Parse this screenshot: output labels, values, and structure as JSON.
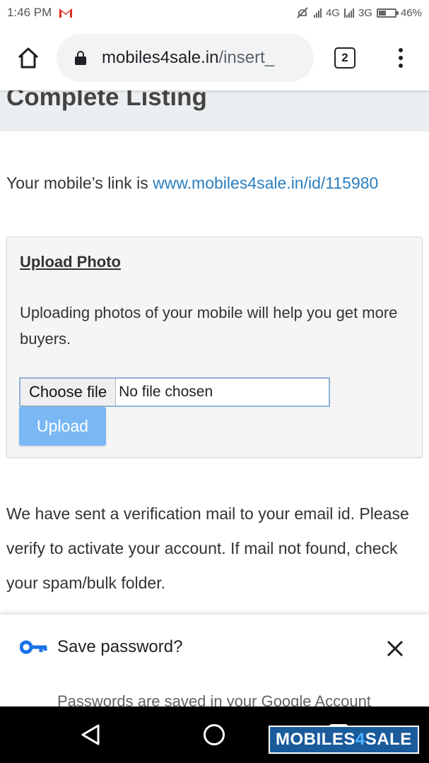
{
  "status_bar": {
    "time": "1:46 PM",
    "network1": "4G",
    "network2": "3G",
    "battery": "46%",
    "battery_level": 0.46
  },
  "browser": {
    "url_host": "mobiles4sale.in",
    "url_path": "/insert_",
    "tab_count": "2"
  },
  "page": {
    "title": "Complete Listing",
    "link_prefix": "Your mobile’s link is",
    "link_url": "www.mobiles4sale.in/id/115980",
    "upload_panel": {
      "title": "Upload Photo",
      "description": "Uploading photos of your mobile will help you get more buyers.",
      "choose_file_label": "Choose file",
      "no_file_text": "No file chosen",
      "upload_label": "Upload"
    },
    "verification_message": "We have sent a verification mail to your email id. Please verify to activate your account. If mail not found, check your spam/bulk folder."
  },
  "save_password": {
    "title": "Save password?",
    "subtitle": "Passwords are saved in your Google Account"
  },
  "watermark": {
    "part1": "MOBILES",
    "part2": "4",
    "part3": "SALE"
  },
  "colors": {
    "link": "#2a7fc0",
    "upload_button": "#7ab8f5",
    "key_icon": "#1a73e8",
    "gmail_red": "#d93025"
  }
}
